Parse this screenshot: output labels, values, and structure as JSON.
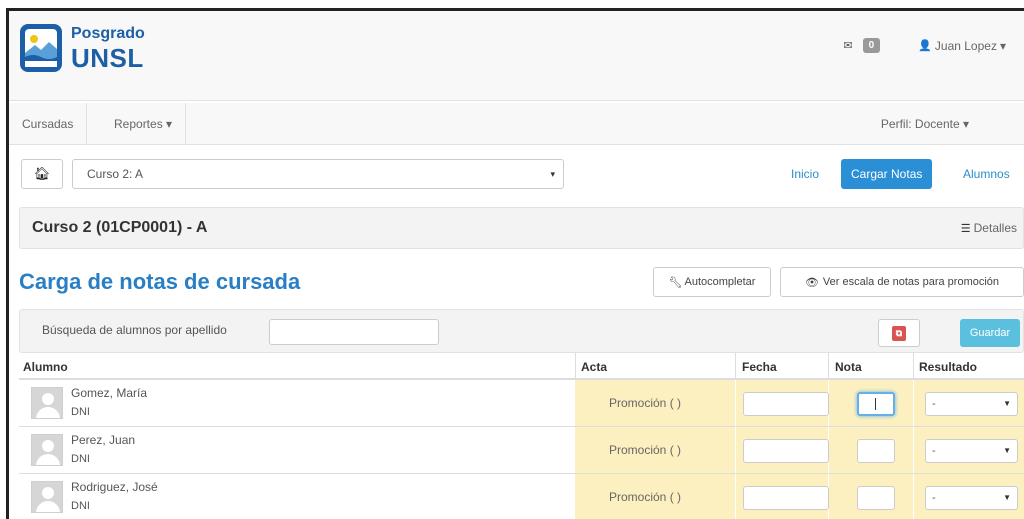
{
  "header": {
    "logo_line1": "Posgrado",
    "logo_line2": "UNSL",
    "messages_count": "0",
    "user_name": "Juan Lopez",
    "user_caret": "▾",
    "brand_color": "#1d5fa6"
  },
  "nav": {
    "cursadas": "Cursadas",
    "reportes": "Reportes",
    "reportes_caret": "▾",
    "perfil": "Perfil: Docente",
    "perfil_caret": "▾"
  },
  "course_selector": {
    "home_icon": "home-icon",
    "selected_course": "Curso 2: A",
    "caret": "▾",
    "links": {
      "inicio": "Inicio",
      "cargar_notas": "Cargar Notas",
      "alumnos": "Alumnos"
    },
    "active_color": "#2b8fd6"
  },
  "course_panel": {
    "title": "Curso 2 (01CP0001) - A",
    "details_label": "Detalles"
  },
  "page": {
    "heading": "Carga de notas de cursada",
    "autocomplete_label": "Autocompletar",
    "scale_label": "Ver escala de notas para promoción"
  },
  "search": {
    "label": "Búsqueda de alumnos por apellido",
    "value": "",
    "pdf_icon": "pdf-icon",
    "save_label": "Guardar"
  },
  "table": {
    "columns": [
      "Alumno",
      "Acta",
      "Fecha",
      "Nota",
      "Resultado"
    ],
    "rows": [
      {
        "name": "Gomez, María",
        "dni": "DNI",
        "acta": "Promoción ( )",
        "fecha": "",
        "nota": "",
        "resultado": "-"
      },
      {
        "name": "Perez, Juan",
        "dni": "DNI",
        "acta": "Promoción ( )",
        "fecha": "",
        "nota": "",
        "resultado": "-"
      },
      {
        "name": "Rodriguez, José",
        "dni": "DNI",
        "acta": "Promoción ( )",
        "fecha": "",
        "nota": "",
        "resultado": "-"
      }
    ],
    "highlight_color": "#fcf0c0"
  }
}
